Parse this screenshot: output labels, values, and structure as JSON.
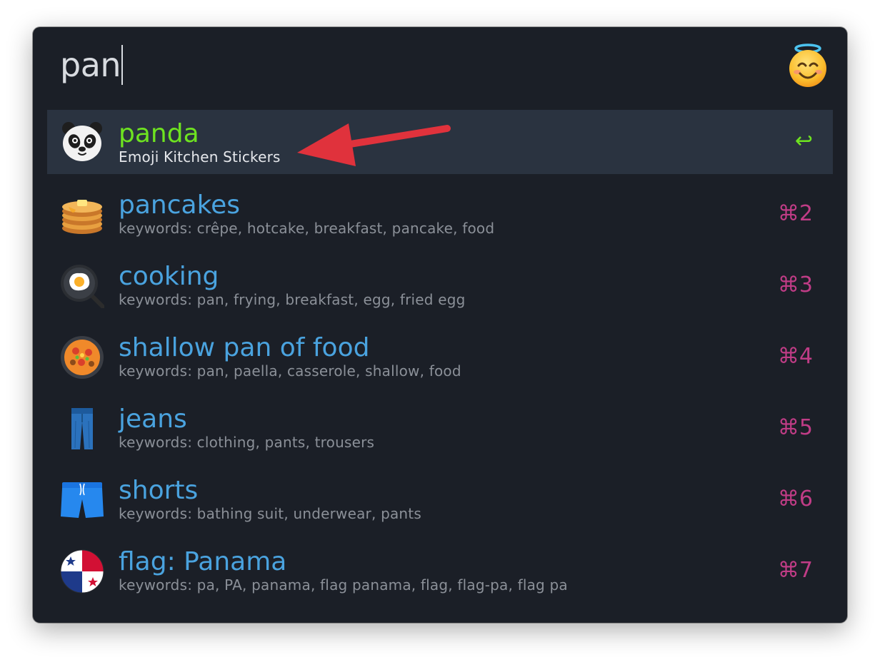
{
  "search": {
    "query": "pan"
  },
  "header_icon": "smiling-face-with-halo-icon",
  "results": [
    {
      "icon": "panda-icon",
      "title": "panda",
      "subtitle": "Emoji Kitchen Stickers",
      "shortcut": "↩",
      "selected": true
    },
    {
      "icon": "pancakes-icon",
      "title": "pancakes",
      "subtitle": "keywords: crêpe, hotcake, breakfast, pancake, food",
      "shortcut": "⌘2"
    },
    {
      "icon": "cooking-icon",
      "title": "cooking",
      "subtitle": "keywords: pan, frying, breakfast, egg, fried egg",
      "shortcut": "⌘3"
    },
    {
      "icon": "shallow-pan-of-food-icon",
      "title": "shallow pan of food",
      "subtitle": "keywords: pan, paella, casserole, shallow, food",
      "shortcut": "⌘4"
    },
    {
      "icon": "jeans-icon",
      "title": "jeans",
      "subtitle": "keywords: clothing, pants, trousers",
      "shortcut": "⌘5"
    },
    {
      "icon": "shorts-icon",
      "title": "shorts",
      "subtitle": "keywords: bathing suit, underwear, pants",
      "shortcut": "⌘6"
    },
    {
      "icon": "flag-panama-icon",
      "title": "flag: Panama",
      "subtitle": "keywords: pa, PA, panama, flag panama, flag, flag-pa, flag pa",
      "shortcut": "⌘7"
    }
  ],
  "colors": {
    "background": "#1b1f27",
    "selected_row": "#2a3340",
    "selected_text": "#6ee320",
    "title_text": "#4aa3df",
    "subtitle_text": "#8b9098",
    "shortcut_text": "#c03c86",
    "annotation_arrow": "#e0323c"
  }
}
